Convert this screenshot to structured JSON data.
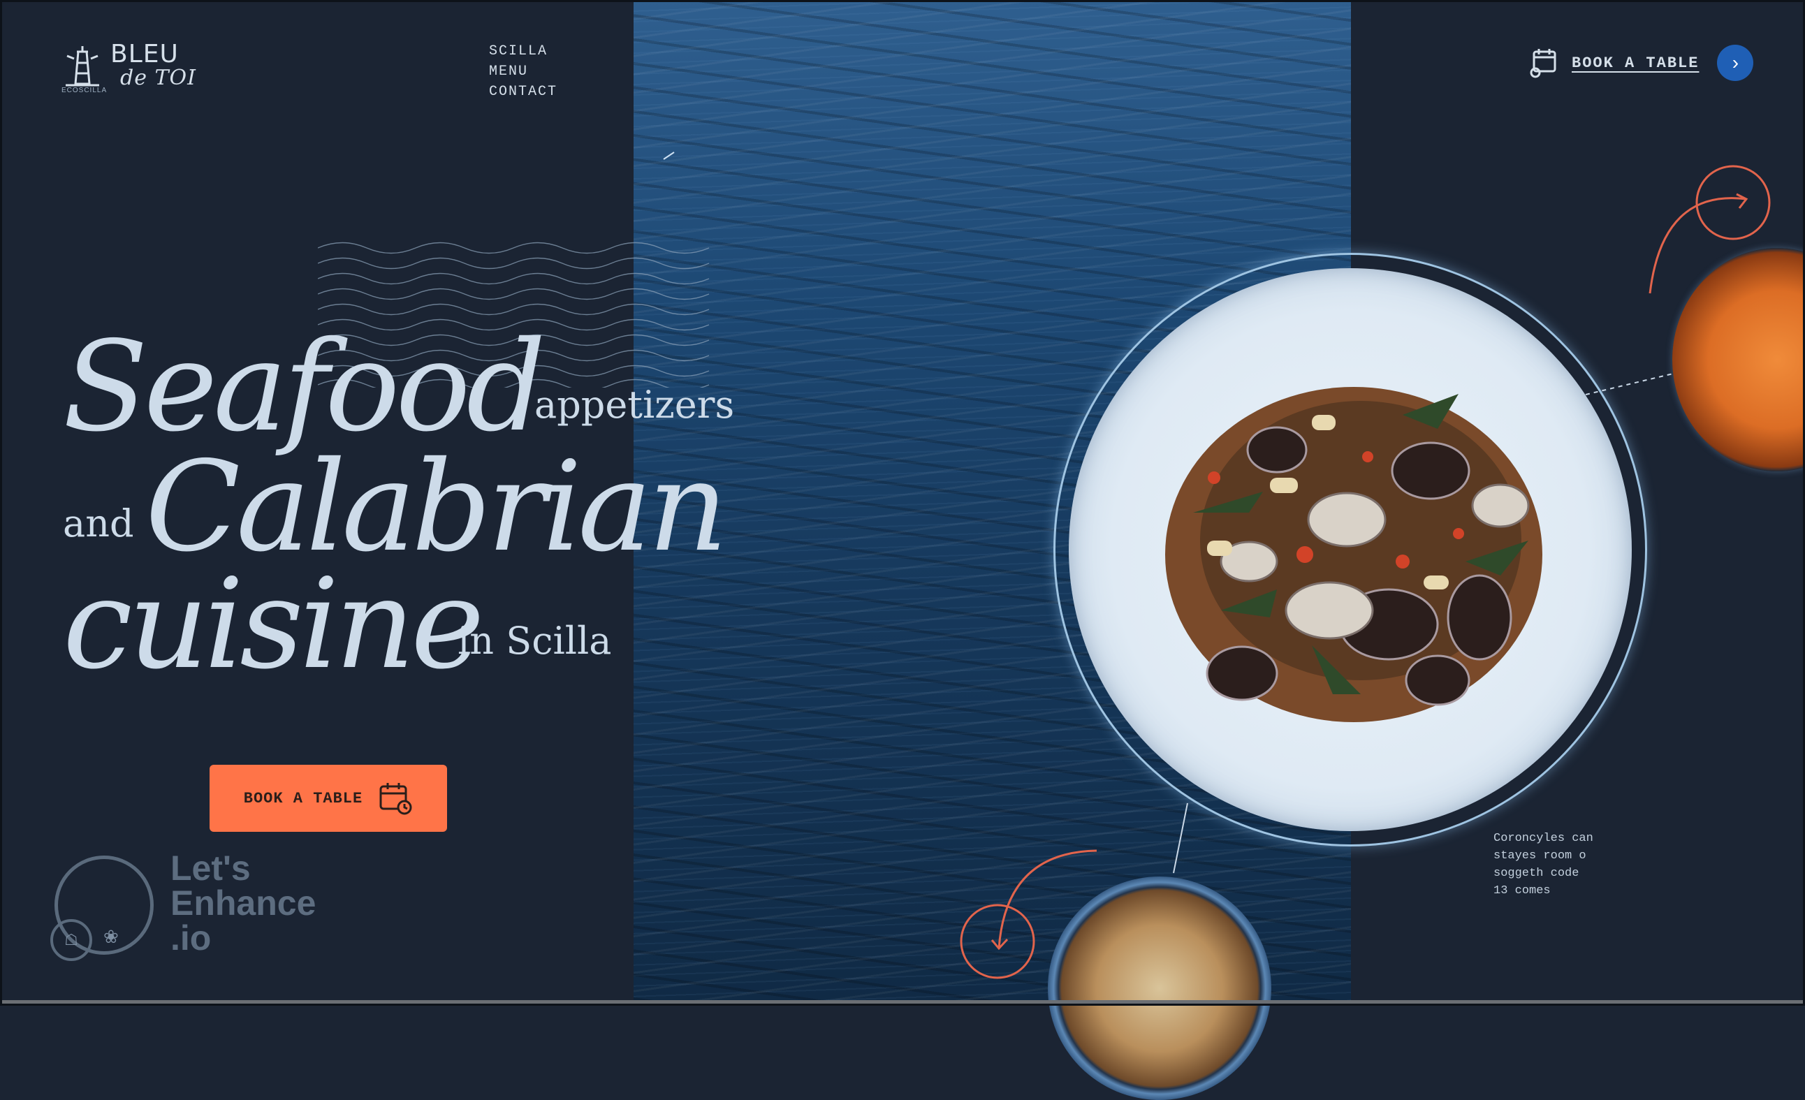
{
  "brand": {
    "name_line1": "BLEU",
    "name_line2": "de TOI",
    "sub": "ECOSCILLA"
  },
  "nav": {
    "items": [
      "SCILLA",
      "MENU",
      "CONTACT"
    ]
  },
  "header_cta": {
    "label": "BOOK A TABLE",
    "arrow": "chevron-right-icon"
  },
  "headline": {
    "w1": "Seafood",
    "w2": "appetizers",
    "w3": "and",
    "w4": "Calabrian",
    "w5": "cuisine",
    "w6": "in Scilla"
  },
  "cta": {
    "label": "BOOK A TABLE",
    "icon": "calendar-icon"
  },
  "watermark": {
    "l1": "Let's",
    "l2": "Enhance",
    "l3": ".io"
  },
  "caption": {
    "lines": [
      "Coroncyles can",
      "stayes room o",
      "soggeth code",
      "13 comes"
    ]
  },
  "colors": {
    "background": "#1b2433",
    "accent": "#ff7448",
    "button_blue": "#1f5fb5",
    "ring": "#e2644c"
  }
}
